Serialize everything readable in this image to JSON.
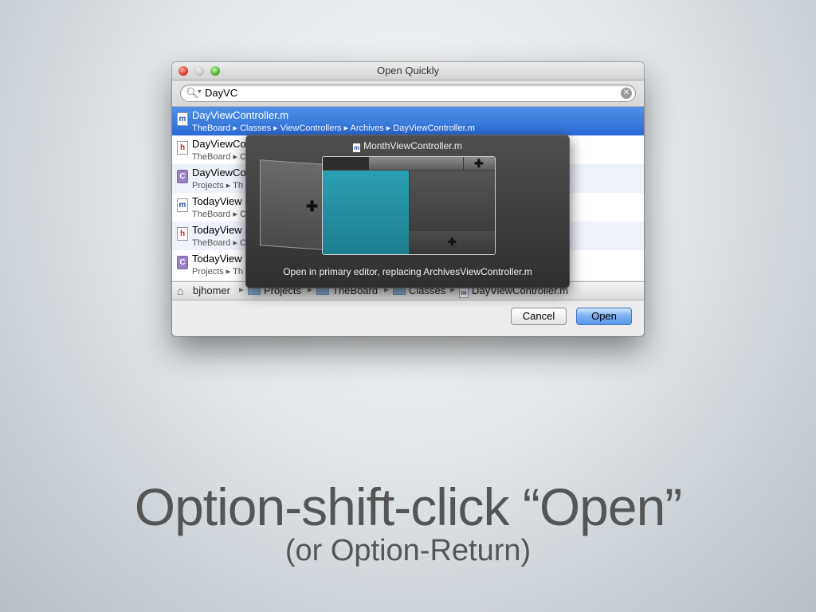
{
  "window": {
    "title": "Open Quickly",
    "search": {
      "value": "DayVC"
    },
    "results": [
      {
        "name": "DayViewController.m",
        "path": "TheBoard ▸ Classes ▸ ViewControllers ▸ Archives ▸ DayViewController.m",
        "icon": "m",
        "selected": true
      },
      {
        "name": "DayViewCo",
        "path": "TheBoard ▸ C",
        "icon": "h"
      },
      {
        "name": "DayViewCo",
        "path": "Projects ▸ Th",
        "icon": "c"
      },
      {
        "name": "TodayView",
        "path": "TheBoard ▸ C",
        "icon": "m"
      },
      {
        "name": "TodayView",
        "path": "TheBoard ▸ C",
        "icon": "h"
      },
      {
        "name": "TodayView",
        "path": "Projects ▸ Th",
        "icon": "c"
      }
    ],
    "pathbar": {
      "home": "bjhomer",
      "items": [
        "Projects",
        "TheBoard",
        "Classes",
        "DayViewController.m"
      ]
    },
    "buttons": {
      "cancel": "Cancel",
      "open": "Open"
    }
  },
  "hud": {
    "title": "MonthViewController.m",
    "caption": "Open in primary editor, replacing ArchivesViewController.m"
  },
  "slide": {
    "caption_main": "Option-shift-click “Open”",
    "caption_sub": "(or Option-Return)"
  }
}
